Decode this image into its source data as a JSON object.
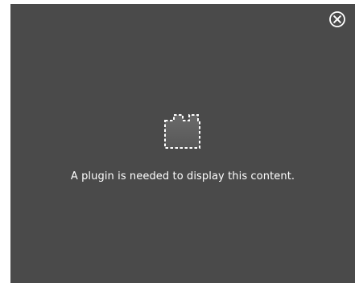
{
  "plugin_placeholder": {
    "message": "A plugin is needed to display this content.",
    "close_icon": "close-circle-icon",
    "plugin_icon": "puzzle-piece-icon",
    "colors": {
      "background": "#4a4a4a",
      "text": "#ffffff",
      "icon_fill": "#616161",
      "icon_stroke": "#ffffff"
    }
  }
}
